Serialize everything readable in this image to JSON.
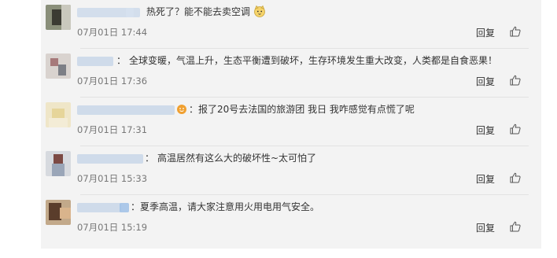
{
  "comments": [
    {
      "text": "热死了？能不能去卖空调",
      "separator": "",
      "time": "07月01日 17:44",
      "reply": "回复",
      "emoji": "cat-face-icon",
      "like_icon": "thumbs-up-icon"
    },
    {
      "text": "全球变暖，气温上升，生态平衡遭到破坏，生存环境发生重大改变，人类都是自食恶果！",
      "separator": "：",
      "time": "07月01日 17:36",
      "reply": "回复",
      "like_icon": "thumbs-up-icon"
    },
    {
      "text": "报了20号去法国的旅游团 我日 我咋感觉有点慌了呢",
      "separator": "：",
      "time": "07月01日 17:31",
      "reply": "回复",
      "emoji": "smiley-badge-icon",
      "like_icon": "thumbs-up-icon"
    },
    {
      "text": "高温居然有这么大的破坏性~太可怕了",
      "separator": "：",
      "time": "07月01日 15:33",
      "reply": "回复",
      "like_icon": "thumbs-up-icon"
    },
    {
      "text": "夏季高温，请大家注意用火用电用气安全。",
      "separator": "：",
      "time": "07月01日 15:19",
      "reply": "回复",
      "like_icon": "thumbs-up-icon"
    }
  ]
}
